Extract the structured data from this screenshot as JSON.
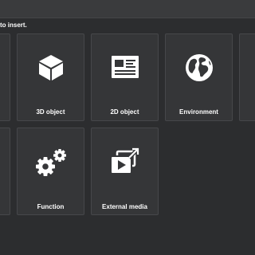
{
  "instruction": "to insert.",
  "tiles": [
    {
      "label": "3D object",
      "icon": "cube-icon"
    },
    {
      "label": "2D object",
      "icon": "browser-window-icon"
    },
    {
      "label": "Environment",
      "icon": "globe-icon"
    },
    {
      "label": "Function",
      "icon": "gears-icon"
    },
    {
      "label": "External media",
      "icon": "external-media-icon"
    }
  ]
}
